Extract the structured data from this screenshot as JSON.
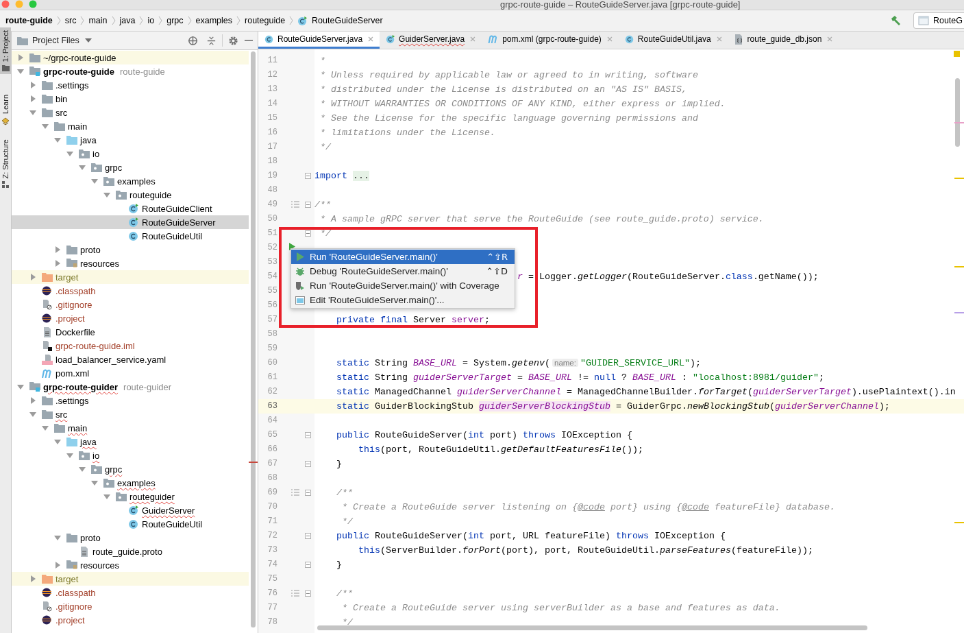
{
  "window": {
    "title": "grpc-route-guide – RouteGuideServer.java [grpc-route-guide]"
  },
  "breadcrumbs": [
    {
      "label": "route-guide",
      "kind": "project"
    },
    {
      "label": "src",
      "kind": "folder"
    },
    {
      "label": "main",
      "kind": "folder"
    },
    {
      "label": "java",
      "kind": "folder"
    },
    {
      "label": "io",
      "kind": "folder"
    },
    {
      "label": "grpc",
      "kind": "folder"
    },
    {
      "label": "examples",
      "kind": "folder"
    },
    {
      "label": "routeguide",
      "kind": "folder"
    },
    {
      "label": "RouteGuideServer",
      "kind": "class"
    }
  ],
  "run_config": {
    "label": "RouteG"
  },
  "side_tabs": [
    {
      "label": "1: Project",
      "kind": "project",
      "selected": true
    },
    {
      "label": "Learn",
      "kind": "learn",
      "selected": false
    },
    {
      "label": "Z: Structure",
      "kind": "structure",
      "selected": false
    }
  ],
  "project": {
    "title": "Project Files",
    "tree": [
      {
        "label": "~/grpc-route-guide",
        "kind": "folder",
        "expanded": false,
        "selected": false,
        "highlighted": true
      },
      {
        "label": "grpc-route-guide",
        "hint": "route-guide",
        "kind": "module",
        "expanded": true,
        "selected": false,
        "children": [
          {
            "label": ".settings",
            "kind": "folder",
            "expanded": false,
            "selected": false
          },
          {
            "label": "bin",
            "kind": "folder",
            "expanded": false,
            "selected": false
          },
          {
            "label": "src",
            "kind": "folder",
            "expanded": true,
            "selected": false,
            "children": [
              {
                "label": "main",
                "kind": "folder",
                "expanded": true,
                "selected": false,
                "children": [
                  {
                    "label": "java",
                    "kind": "source-folder",
                    "expanded": true,
                    "selected": false,
                    "children": [
                      {
                        "label": "io",
                        "kind": "package",
                        "expanded": true,
                        "selected": false,
                        "children": [
                          {
                            "label": "grpc",
                            "kind": "package",
                            "expanded": true,
                            "selected": false,
                            "children": [
                              {
                                "label": "examples",
                                "kind": "package",
                                "expanded": true,
                                "selected": false,
                                "children": [
                                  {
                                    "label": "routeguide",
                                    "kind": "package",
                                    "expanded": true,
                                    "selected": false,
                                    "children": [
                                      {
                                        "label": "RouteGuideClient",
                                        "kind": "main-class",
                                        "selected": false
                                      },
                                      {
                                        "label": "RouteGuideServer",
                                        "kind": "main-class",
                                        "selected": true
                                      },
                                      {
                                        "label": "RouteGuideUtil",
                                        "kind": "class",
                                        "selected": false
                                      }
                                    ]
                                  }
                                ]
                              }
                            ]
                          }
                        ]
                      }
                    ]
                  },
                  {
                    "label": "proto",
                    "kind": "folder",
                    "expanded": false,
                    "selected": false
                  },
                  {
                    "label": "resources",
                    "kind": "resources-folder",
                    "expanded": false,
                    "selected": false
                  }
                ]
              }
            ]
          },
          {
            "label": "target",
            "kind": "excluded-folder",
            "expanded": false,
            "selected": false,
            "highlighted": true,
            "excluded": true
          },
          {
            "label": ".classpath",
            "kind": "eclipse-file",
            "selected": false,
            "ignored": true
          },
          {
            "label": ".gitignore",
            "kind": "ignore-file",
            "selected": false,
            "ignored": true
          },
          {
            "label": ".project",
            "kind": "eclipse-file",
            "selected": false,
            "ignored": true
          },
          {
            "label": "Dockerfile",
            "kind": "text-file",
            "selected": false
          },
          {
            "label": "grpc-route-guide.iml",
            "kind": "module-file",
            "selected": false,
            "ignored": true
          },
          {
            "label": "load_balancer_service.yaml",
            "kind": "yaml-file",
            "selected": false
          },
          {
            "label": "pom.xml",
            "kind": "maven-file",
            "selected": false
          }
        ]
      },
      {
        "label": "grpc-route-guider",
        "hint": "route-guider",
        "kind": "module",
        "expanded": true,
        "selected": false,
        "typo": true,
        "children": [
          {
            "label": ".settings",
            "kind": "folder",
            "expanded": false,
            "selected": false
          },
          {
            "label": "src",
            "kind": "folder",
            "expanded": true,
            "selected": false,
            "typo": true,
            "children": [
              {
                "label": "main",
                "kind": "folder",
                "expanded": true,
                "selected": false,
                "typo": true,
                "children": [
                  {
                    "label": "java",
                    "kind": "source-folder",
                    "expanded": true,
                    "selected": false,
                    "typo": true,
                    "children": [
                      {
                        "label": "io",
                        "kind": "package",
                        "expanded": true,
                        "selected": false,
                        "typo": true,
                        "children": [
                          {
                            "label": "grpc",
                            "kind": "package",
                            "expanded": true,
                            "selected": false,
                            "typo": true,
                            "children": [
                              {
                                "label": "examples",
                                "kind": "package",
                                "expanded": true,
                                "selected": false,
                                "typo": true,
                                "children": [
                                  {
                                    "label": "routeguider",
                                    "kind": "package",
                                    "expanded": true,
                                    "selected": false,
                                    "typo": true,
                                    "children": [
                                      {
                                        "label": "GuiderServer",
                                        "kind": "main-class",
                                        "selected": false,
                                        "typo": true
                                      },
                                      {
                                        "label": "RouteGuideUtil",
                                        "kind": "class",
                                        "selected": false
                                      }
                                    ]
                                  }
                                ]
                              }
                            ]
                          }
                        ]
                      }
                    ]
                  },
                  {
                    "label": "proto",
                    "kind": "folder",
                    "expanded": true,
                    "selected": false,
                    "children": [
                      {
                        "label": "route_guide.proto",
                        "kind": "text-file",
                        "selected": false
                      }
                    ]
                  },
                  {
                    "label": "resources",
                    "kind": "resources-folder",
                    "expanded": false,
                    "selected": false
                  }
                ]
              }
            ]
          },
          {
            "label": "target",
            "kind": "excluded-folder",
            "expanded": false,
            "selected": false,
            "highlighted": true,
            "excluded": true
          },
          {
            "label": ".classpath",
            "kind": "eclipse-file",
            "selected": false,
            "ignored": true
          },
          {
            "label": ".gitignore",
            "kind": "ignore-file",
            "selected": false,
            "ignored": true
          },
          {
            "label": ".project",
            "kind": "eclipse-file",
            "selected": false,
            "ignored": true
          }
        ]
      }
    ]
  },
  "editor": {
    "tabs": [
      {
        "label": "RouteGuideServer.java",
        "kind": "class",
        "selected": true
      },
      {
        "label": "GuiderServer.java",
        "kind": "main-class",
        "selected": false,
        "typo": true
      },
      {
        "label": "pom.xml (grpc-route-guide)",
        "kind": "maven",
        "selected": false
      },
      {
        "label": "RouteGuideUtil.java",
        "kind": "class",
        "selected": false
      },
      {
        "label": "route_guide_db.json",
        "kind": "json",
        "selected": false
      }
    ],
    "lines": [
      {
        "number": "11",
        "segments": [
          {
            "text": " *",
            "kind": "comment"
          }
        ]
      },
      {
        "number": "12",
        "segments": [
          {
            "text": " * Unless required by applicable law or agreed to in writing, software",
            "kind": "comment"
          }
        ]
      },
      {
        "number": "13",
        "segments": [
          {
            "text": " * distributed under the License is distributed on an \"AS IS\" BASIS,",
            "kind": "comment"
          }
        ]
      },
      {
        "number": "14",
        "segments": [
          {
            "text": " * WITHOUT WARRANTIES OR CONDITIONS OF ANY KIND, either express or implied.",
            "kind": "comment"
          }
        ]
      },
      {
        "number": "15",
        "segments": [
          {
            "text": " * See the License for the specific language governing permissions and",
            "kind": "comment"
          }
        ]
      },
      {
        "number": "16",
        "segments": [
          {
            "text": " * limitations under the License.",
            "kind": "comment"
          }
        ]
      },
      {
        "number": "17",
        "segments": [
          {
            "text": " */",
            "kind": "comment"
          }
        ]
      },
      {
        "number": "18"
      },
      {
        "number": "19",
        "fold": true,
        "segments": [
          {
            "text": "import ",
            "kind": "keyword"
          },
          {
            "text": "...",
            "kind": "folded"
          }
        ]
      },
      {
        "number": "48"
      },
      {
        "number": "49",
        "doc": true,
        "fold": true,
        "segments": [
          {
            "text": "/**",
            "kind": "comment"
          }
        ]
      },
      {
        "number": "50",
        "segments": [
          {
            "text": " * A sample gRPC server that serve the RouteGuide (see route_guide.proto) service.",
            "kind": "comment"
          }
        ]
      },
      {
        "number": "51",
        "fold": true,
        "segments": [
          {
            "text": " */",
            "kind": "comment"
          }
        ]
      },
      {
        "number": "52",
        "run": true
      },
      {
        "number": "53"
      },
      {
        "number": "54",
        "segments": [
          {
            "text": "                                     r",
            "kind": "static-field"
          },
          {
            "text": " = Logger.",
            "kind": "plain"
          },
          {
            "text": "getLogger",
            "kind": "static-call"
          },
          {
            "text": "(RouteGuideServer.",
            "kind": "plain"
          },
          {
            "text": "class",
            "kind": "keyword"
          },
          {
            "text": ".getName());",
            "kind": "plain"
          }
        ]
      },
      {
        "number": "55"
      },
      {
        "number": "56"
      },
      {
        "number": "57",
        "segments": [
          {
            "text": "    private final",
            "kind": "keyword"
          },
          {
            "text": " Server ",
            "kind": "plain"
          },
          {
            "text": "server",
            "kind": "field"
          },
          {
            "text": ";",
            "kind": "plain"
          }
        ]
      },
      {
        "number": "58"
      },
      {
        "number": "59"
      },
      {
        "number": "60",
        "segments": [
          {
            "text": "    static",
            "kind": "keyword"
          },
          {
            "text": " String ",
            "kind": "plain"
          },
          {
            "text": "BASE_URL",
            "kind": "static-field"
          },
          {
            "text": " = System.",
            "kind": "plain"
          },
          {
            "text": "getenv",
            "kind": "static-call"
          },
          {
            "text": "(",
            "kind": "plain"
          },
          {
            "text": "name:",
            "kind": "param-hint"
          },
          {
            "text": "\"GUIDER_SERVICE_URL\"",
            "kind": "string"
          },
          {
            "text": ");",
            "kind": "plain"
          }
        ]
      },
      {
        "number": "61",
        "segments": [
          {
            "text": "    static",
            "kind": "keyword"
          },
          {
            "text": " String ",
            "kind": "plain"
          },
          {
            "text": "guiderServerTarget",
            "kind": "static-field"
          },
          {
            "text": " = ",
            "kind": "plain"
          },
          {
            "text": "BASE_URL",
            "kind": "static-field"
          },
          {
            "text": " != ",
            "kind": "plain"
          },
          {
            "text": "null",
            "kind": "keyword"
          },
          {
            "text": " ? ",
            "kind": "plain"
          },
          {
            "text": "BASE_URL",
            "kind": "static-field"
          },
          {
            "text": " : ",
            "kind": "plain"
          },
          {
            "text": "\"localhost:8981/guider\"",
            "kind": "string"
          },
          {
            "text": ";",
            "kind": "plain"
          }
        ]
      },
      {
        "number": "62",
        "segments": [
          {
            "text": "    static",
            "kind": "keyword"
          },
          {
            "text": " ManagedChannel ",
            "kind": "plain"
          },
          {
            "text": "guiderServerChannel",
            "kind": "static-field"
          },
          {
            "text": " = ManagedChannelBuilder.",
            "kind": "plain"
          },
          {
            "text": "forTarget",
            "kind": "static-call"
          },
          {
            "text": "(",
            "kind": "plain"
          },
          {
            "text": "guiderServerTarget",
            "kind": "static-field"
          },
          {
            "text": ").usePlaintext().in",
            "kind": "plain"
          }
        ]
      },
      {
        "number": "63",
        "current": true,
        "segments": [
          {
            "text": "    static",
            "kind": "keyword"
          },
          {
            "text": " GuiderBlockingStub ",
            "kind": "plain"
          },
          {
            "text": "guiderServerBlockingStub",
            "kind": "marked-field"
          },
          {
            "text": " = GuiderGrpc.",
            "kind": "plain"
          },
          {
            "text": "newBlockingStub",
            "kind": "static-call"
          },
          {
            "text": "(",
            "kind": "plain"
          },
          {
            "text": "guiderServerChannel",
            "kind": "static-field"
          },
          {
            "text": ");",
            "kind": "plain"
          }
        ]
      },
      {
        "number": "64"
      },
      {
        "number": "65",
        "fold": true,
        "segments": [
          {
            "text": "    public",
            "kind": "keyword"
          },
          {
            "text": " RouteGuideServer(",
            "kind": "plain"
          },
          {
            "text": "int",
            "kind": "keyword"
          },
          {
            "text": " port) ",
            "kind": "plain"
          },
          {
            "text": "throws",
            "kind": "keyword"
          },
          {
            "text": " IOException {",
            "kind": "plain"
          }
        ]
      },
      {
        "number": "66",
        "segments": [
          {
            "text": "        this",
            "kind": "keyword"
          },
          {
            "text": "(port, RouteGuideUtil.",
            "kind": "plain"
          },
          {
            "text": "getDefaultFeaturesFile",
            "kind": "static-call"
          },
          {
            "text": "());",
            "kind": "plain"
          }
        ]
      },
      {
        "number": "67",
        "fold": true,
        "segments": [
          {
            "text": "    }",
            "kind": "plain"
          }
        ]
      },
      {
        "number": "68"
      },
      {
        "number": "69",
        "doc": true,
        "fold": true,
        "segments": [
          {
            "text": "    /**",
            "kind": "comment"
          }
        ]
      },
      {
        "number": "70",
        "segments": [
          {
            "text": "     * Create a RouteGuide server listening on {",
            "kind": "comment"
          },
          {
            "text": "@code",
            "kind": "doc-tag"
          },
          {
            "text": " port} using {",
            "kind": "comment"
          },
          {
            "text": "@code",
            "kind": "doc-tag"
          },
          {
            "text": " featureFile} database.",
            "kind": "comment"
          }
        ]
      },
      {
        "number": "71",
        "segments": [
          {
            "text": "     */",
            "kind": "comment"
          }
        ]
      },
      {
        "number": "72",
        "fold": true,
        "segments": [
          {
            "text": "    public",
            "kind": "keyword"
          },
          {
            "text": " RouteGuideServer(",
            "kind": "plain"
          },
          {
            "text": "int",
            "kind": "keyword"
          },
          {
            "text": " port, URL featureFile) ",
            "kind": "plain"
          },
          {
            "text": "throws",
            "kind": "keyword"
          },
          {
            "text": " IOException {",
            "kind": "plain"
          }
        ]
      },
      {
        "number": "73",
        "segments": [
          {
            "text": "        this",
            "kind": "keyword"
          },
          {
            "text": "(ServerBuilder.",
            "kind": "plain"
          },
          {
            "text": "forPort",
            "kind": "static-call"
          },
          {
            "text": "(port), port, RouteGuideUtil.",
            "kind": "plain"
          },
          {
            "text": "parseFeatures",
            "kind": "static-call"
          },
          {
            "text": "(featureFile));",
            "kind": "plain"
          }
        ]
      },
      {
        "number": "74",
        "fold": true,
        "segments": [
          {
            "text": "    }",
            "kind": "plain"
          }
        ]
      },
      {
        "number": "75"
      },
      {
        "number": "76",
        "doc": true,
        "fold": true,
        "segments": [
          {
            "text": "    /**",
            "kind": "comment"
          }
        ]
      },
      {
        "number": "77",
        "segments": [
          {
            "text": "     * Create a RouteGuide server using serverBuilder as a base and features as data.",
            "kind": "comment"
          }
        ]
      },
      {
        "number": "78",
        "segments": [
          {
            "text": "     */",
            "kind": "comment"
          }
        ]
      }
    ],
    "popup": [
      {
        "label": "Run 'RouteGuideServer.main()'",
        "kind": "run",
        "shortcut": "⌃⇧R",
        "selected": true
      },
      {
        "label": "Debug 'RouteGuideServer.main()'",
        "kind": "debug",
        "shortcut": "⌃⇧D",
        "selected": false
      },
      {
        "label": "Run 'RouteGuideServer.main()' with Coverage",
        "kind": "coverage",
        "selected": false
      },
      {
        "label": "Edit 'RouteGuideServer.main()'...",
        "kind": "edit",
        "selected": false
      }
    ]
  }
}
